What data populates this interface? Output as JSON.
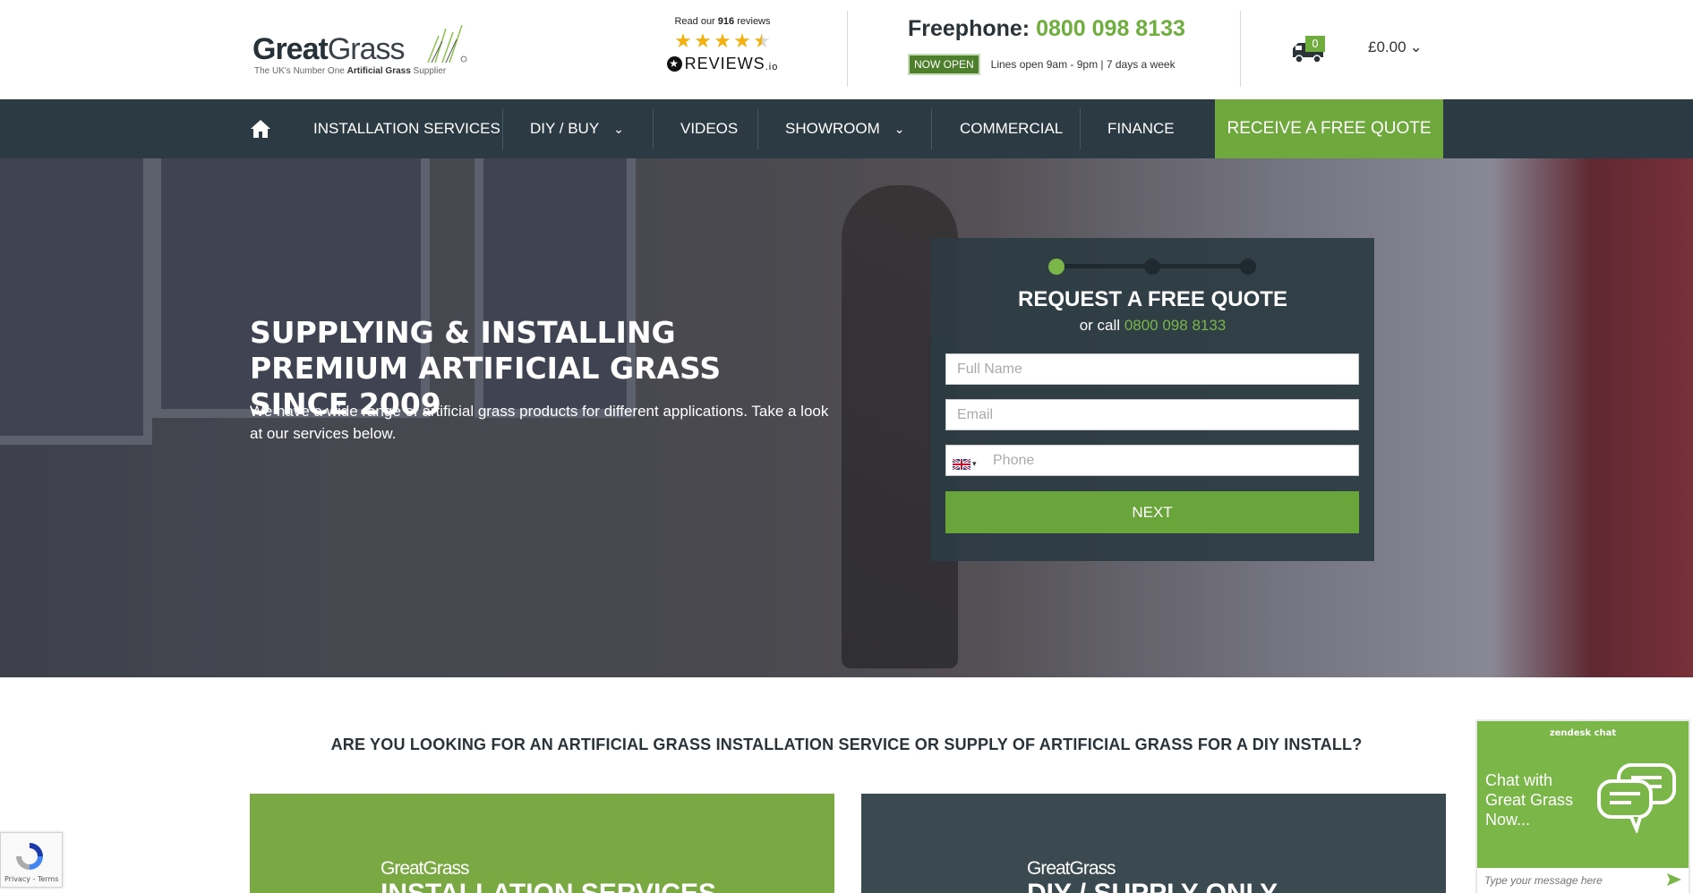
{
  "header": {
    "logo": {
      "word1": "Great",
      "word2": "Grass",
      "tagline_pre": "The UK's Number One ",
      "tagline_bold": "Artificial Grass",
      "tagline_post": " Supplier"
    },
    "reviews": {
      "pre": "Read our",
      "count": "916",
      "post": "reviews",
      "rating": 4.5,
      "brand": "REVIEWS",
      "brand_suffix": ".io"
    },
    "phone": {
      "label": "Freephone:",
      "number": "0800 098 8133",
      "status": "NOW OPEN",
      "hours": "Lines open 9am - 9pm | 7 days a week"
    },
    "cart": {
      "count": "0",
      "total": "£0.00"
    }
  },
  "nav": {
    "items": [
      {
        "label": "INSTALLATION SERVICES"
      },
      {
        "label": "DIY / BUY"
      },
      {
        "label": "VIDEOS"
      },
      {
        "label": "SHOWROOM"
      },
      {
        "label": "COMMERCIAL"
      },
      {
        "label": "FINANCE"
      }
    ],
    "cta": "RECEIVE A FREE QUOTE"
  },
  "hero": {
    "title": "SUPPLYING & INSTALLING PREMIUM ARTIFICIAL GRASS SINCE 2009",
    "subtitle": "We have a wide range of artificial grass products for different applications. Take a look at our services below."
  },
  "quote_form": {
    "title": "REQUEST A FREE QUOTE",
    "call_pre": "or call",
    "call_number": "0800 098 8133",
    "name_placeholder": "Full Name",
    "email_placeholder": "Email",
    "phone_placeholder": "Phone",
    "submit": "NEXT",
    "current_step": 1,
    "total_steps": 3
  },
  "services": {
    "question": "ARE YOU LOOKING FOR AN ARTIFICIAL GRASS INSTALLATION SERVICE OR SUPPLY OF ARTIFICIAL GRASS FOR A DIY INSTALL?",
    "cards": [
      {
        "logo": "GreatGrass",
        "heading": "INSTALLATION SERVICES"
      },
      {
        "logo": "GreatGrass",
        "heading": "DIY / SUPPLY ONLY"
      }
    ]
  },
  "recaptcha": {
    "links": "Privacy - Terms"
  },
  "chat": {
    "brand": "zendesk chat",
    "title": "Chat with Great Grass Now...",
    "placeholder": "Type your message here"
  },
  "colors": {
    "brand_green": "#6fae3e",
    "nav_bg": "#2c3b43",
    "cta_green": "#6fa83c"
  }
}
